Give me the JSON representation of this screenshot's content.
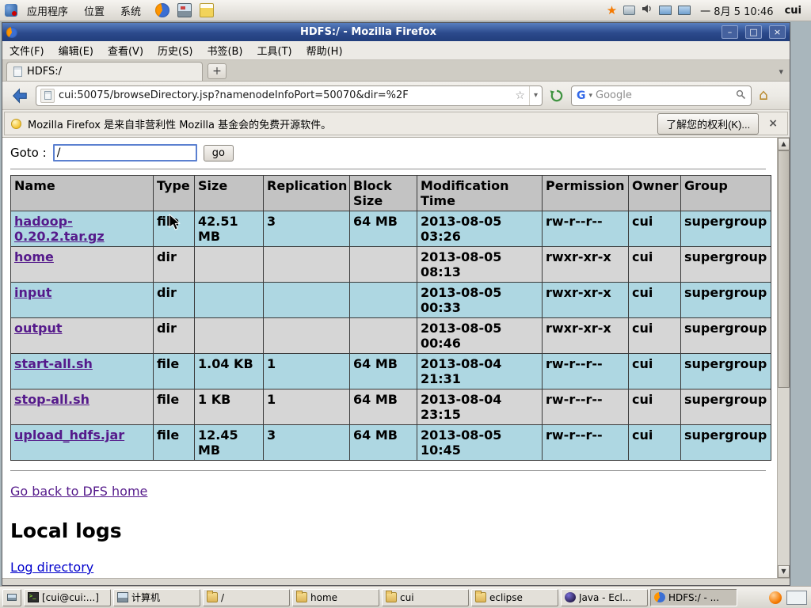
{
  "panel": {
    "menus": [
      "应用程序",
      "位置",
      "系统"
    ],
    "clock": "一 8月 5 10:46",
    "user": "cui"
  },
  "window": {
    "title": "HDFS:/ - Mozilla Firefox",
    "menubar": [
      "文件(F)",
      "编辑(E)",
      "查看(V)",
      "历史(S)",
      "书签(B)",
      "工具(T)",
      "帮助(H)"
    ],
    "tab_label": "HDFS:/",
    "url": "cui:50075/browseDirectory.jsp?namenodeInfoPort=50070&dir=%2F",
    "search_placeholder": "Google",
    "notice": {
      "text": "Mozilla Firefox 是来自非营利性 Mozilla 基金会的免费开源软件。",
      "button": "了解您的权利(K)..."
    }
  },
  "page": {
    "goto": {
      "label": "Goto :",
      "value": "/",
      "button": "go"
    },
    "listing": {
      "headers": [
        "Name",
        "Type",
        "Size",
        "Replication",
        "Block Size",
        "Modification Time",
        "Permission",
        "Owner",
        "Group"
      ],
      "rows": [
        {
          "name": "hadoop-0.20.2.tar.gz",
          "type": "file",
          "size": "42.51 MB",
          "replication": "3",
          "block_size": "64 MB",
          "modification_time": "2013-08-05 03:26",
          "permission": "rw-r--r--",
          "owner": "cui",
          "group": "supergroup"
        },
        {
          "name": "home",
          "type": "dir",
          "size": "",
          "replication": "",
          "block_size": "",
          "modification_time": "2013-08-05 08:13",
          "permission": "rwxr-xr-x",
          "owner": "cui",
          "group": "supergroup"
        },
        {
          "name": "input",
          "type": "dir",
          "size": "",
          "replication": "",
          "block_size": "",
          "modification_time": "2013-08-05 00:33",
          "permission": "rwxr-xr-x",
          "owner": "cui",
          "group": "supergroup"
        },
        {
          "name": "output",
          "type": "dir",
          "size": "",
          "replication": "",
          "block_size": "",
          "modification_time": "2013-08-05 00:46",
          "permission": "rwxr-xr-x",
          "owner": "cui",
          "group": "supergroup"
        },
        {
          "name": "start-all.sh",
          "type": "file",
          "size": "1.04 KB",
          "replication": "1",
          "block_size": "64 MB",
          "modification_time": "2013-08-04 21:31",
          "permission": "rw-r--r--",
          "owner": "cui",
          "group": "supergroup"
        },
        {
          "name": "stop-all.sh",
          "type": "file",
          "size": "1 KB",
          "replication": "1",
          "block_size": "64 MB",
          "modification_time": "2013-08-04 23:15",
          "permission": "rw-r--r--",
          "owner": "cui",
          "group": "supergroup"
        },
        {
          "name": "upload_hdfs.jar",
          "type": "file",
          "size": "12.45 MB",
          "replication": "3",
          "block_size": "64 MB",
          "modification_time": "2013-08-05 10:45",
          "permission": "rw-r--r--",
          "owner": "cui",
          "group": "supergroup"
        }
      ]
    },
    "back_link": "Go back to DFS home",
    "local_logs_heading": "Local logs",
    "log_directory_link": "Log directory"
  },
  "taskbar": {
    "tasks": [
      {
        "label": "[cui@cui:...]",
        "icon": "terminal"
      },
      {
        "label": "计算机",
        "icon": "computer"
      },
      {
        "label": "/",
        "icon": "folder"
      },
      {
        "label": "home",
        "icon": "folder"
      },
      {
        "label": "cui",
        "icon": "folder"
      },
      {
        "label": "eclipse",
        "icon": "folder"
      },
      {
        "label": "Java - Ecl...",
        "icon": "eclipse"
      },
      {
        "label": "HDFS:/ - ...",
        "icon": "firefox",
        "active": true
      }
    ]
  },
  "icons": {
    "minimize": "–",
    "maximize": "□",
    "close": "×",
    "new_tab": "+",
    "dropdown": "▾",
    "bookmark_star": "☆",
    "home": "⌂",
    "scroll_up": "▲",
    "scroll_down": "▼",
    "google_g": "G",
    "star_tray": "★",
    "notice_close": "×"
  },
  "colors": {
    "titlebar_blue": "#2c4a8c",
    "header_gray": "#c3c3c3",
    "row_blue": "#aed7e2",
    "row_gray": "#d6d6d6",
    "visited_link": "#551a8b",
    "link_blue": "#0000cc",
    "chrome_gray": "#ece9e3"
  }
}
